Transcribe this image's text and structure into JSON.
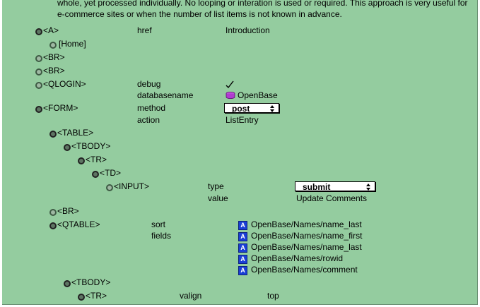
{
  "intro_text": "whole, yet processed individually.  No looping or interation is used or required.  This approach is very useful for e-commerce sites or when the number of list items is not known in advance.",
  "rows": {
    "a": {
      "tag": "<A>",
      "attr": "href",
      "val": "Introduction"
    },
    "home": {
      "tag": "[Home]"
    },
    "br1": {
      "tag": "<BR>"
    },
    "br2": {
      "tag": "<BR>"
    },
    "qlogin": {
      "tag": "<QLOGIN>",
      "attr1": "debug",
      "attr2": "databasename",
      "db_value": "OpenBase"
    },
    "form": {
      "tag": "<FORM>",
      "attr1": "method",
      "method_value": "post",
      "attr2": "action",
      "action_value": "ListEntry"
    },
    "table": {
      "tag": "<TABLE>"
    },
    "tbody": {
      "tag": "<TBODY>"
    },
    "tr": {
      "tag": "<TR>"
    },
    "td": {
      "tag": "<TD>"
    },
    "input": {
      "tag": "<INPUT>",
      "attr1": "type",
      "type_value": "submit",
      "attr2": "value",
      "value_value": "Update Comments"
    },
    "br3": {
      "tag": "<BR>"
    },
    "qtable": {
      "tag": "<QTABLE>",
      "attr1": "sort",
      "attr2": "fields",
      "fields": [
        "OpenBase/Names/name_last",
        "OpenBase/Names/name_first",
        "OpenBase/Names/name_last",
        "OpenBase/Names/rowid",
        "OpenBase/Names/comment"
      ]
    },
    "tbody2": {
      "tag": "<TBODY>"
    },
    "tr2": {
      "tag": "<TR>",
      "attr": "valign",
      "val": "top"
    }
  },
  "icons": {
    "bullet": "tree-bullet-icon",
    "check": "checkmark-icon",
    "database": "database-icon",
    "field": "field-icon",
    "popup_arrows": "popup-arrows-icon"
  },
  "colors": {
    "panel_bg": "#94cc9f",
    "field_icon": "#1a3fd6",
    "db_icon": "#b03cd0"
  }
}
